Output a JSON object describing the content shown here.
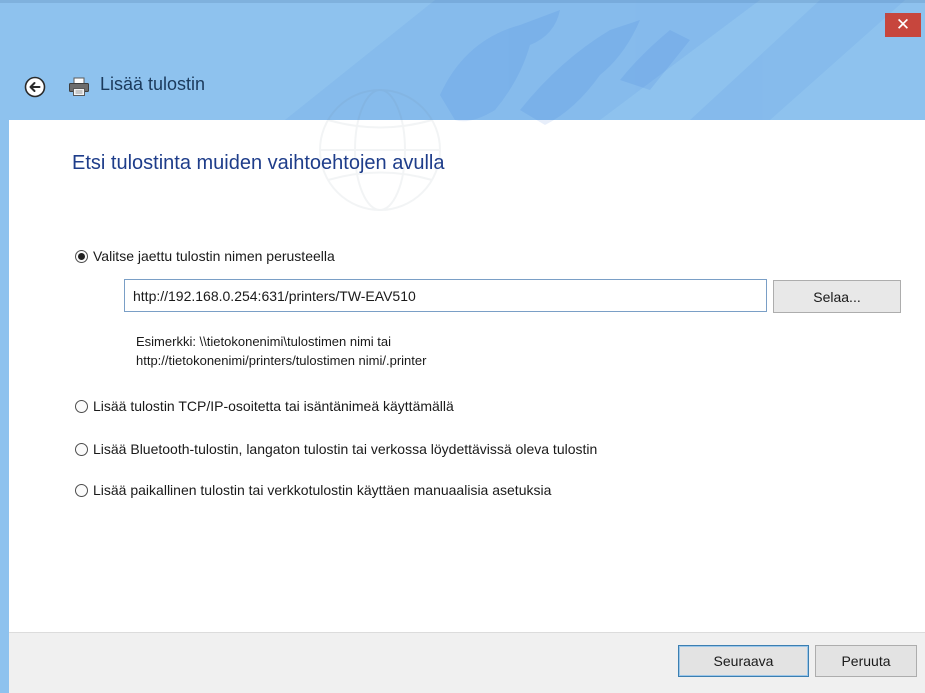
{
  "window": {
    "title": "Lisää tulostin",
    "close_glyph": "✕",
    "back_icon": "back-arrow-icon",
    "title_icon": "printer-icon"
  },
  "main": {
    "heading": "Etsi tulostinta muiden vaihtoehtojen avulla",
    "options": [
      {
        "label": "Valitse jaettu tulostin nimen perusteella",
        "selected": true
      },
      {
        "label": "Lisää tulostin TCP/IP-osoitetta tai isäntänimeä käyttämällä",
        "selected": false
      },
      {
        "label": "Lisää Bluetooth-tulostin, langaton tulostin tai verkossa löydettävissä oleva tulostin",
        "selected": false
      },
      {
        "label": "Lisää paikallinen tulostin tai verkkotulostin käyttäen manuaalisia asetuksia",
        "selected": false
      }
    ],
    "printer_url": "http://192.168.0.254:631/printers/TW-EAV510",
    "browse_label": "Selaa...",
    "example_line1": "Esimerkki: \\\\tietokonenimi\\tulostimen nimi tai",
    "example_line2": "http://tietokonenimi/printers/tulostimen nimi/.printer"
  },
  "footer": {
    "next_label": "Seuraava",
    "cancel_label": "Peruuta"
  },
  "colors": {
    "titlebar": "#8ec2ee",
    "close_button": "#c7463d",
    "heading": "#1e3d8a",
    "watermark": "#1d62d6"
  }
}
